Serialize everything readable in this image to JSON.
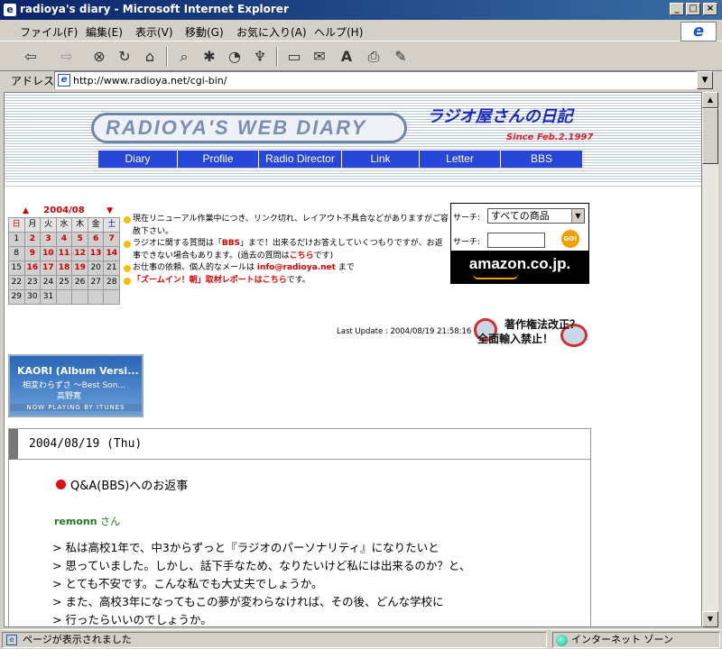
{
  "window": {
    "title": "radioya's diary - Microsoft Internet Explorer",
    "minimize": "_",
    "maximize": "□",
    "close": "×"
  },
  "menu": [
    "ファイル(F)",
    "編集(E)",
    "表示(V)",
    "移動(G)",
    "お気に入り(A)",
    "ヘルプ(H)"
  ],
  "toolbar": {
    "back": "⇦",
    "forward": "⇨",
    "stop": "⊗",
    "refresh": "↻",
    "home": "⌂",
    "search": "⌕",
    "favorites": "✱",
    "history": "◔",
    "channels": "♆",
    "fullscreen": "▭",
    "mail": "✉",
    "font": "A",
    "print": "⎙",
    "edit": "✎"
  },
  "address": {
    "label": "アドレス",
    "url": "http://www.radioya.net/cgi-bin/"
  },
  "banner": {
    "logo": "RADIOYA'S WEB DIARY",
    "jp_title": "ラジオ屋さんの日記",
    "since": "Since Feb.2.1997",
    "nav": [
      "Diary",
      "Profile",
      "Radio Director",
      "Link",
      "Letter",
      "BBS"
    ]
  },
  "calendar": {
    "month": "2004/08",
    "prev": "▲",
    "next": "▼",
    "weekdays": [
      "日",
      "月",
      "火",
      "水",
      "木",
      "金",
      "土"
    ],
    "weeks": [
      [
        "1",
        "2",
        "3",
        "4",
        "5",
        "6",
        "7"
      ],
      [
        "8",
        "9",
        "10",
        "11",
        "12",
        "13",
        "14"
      ],
      [
        "15",
        "16",
        "17",
        "18",
        "19",
        "20",
        "21"
      ],
      [
        "22",
        "23",
        "24",
        "25",
        "26",
        "27",
        "28"
      ],
      [
        "29",
        "30",
        "31",
        "",
        "",
        "",
        ""
      ]
    ]
  },
  "notices": {
    "n1": "現在リニューアル作業中につき、リンク切れ、レイアウト不具合などがありますがご容赦下さい。",
    "n2a": "ラジオに関する質問は「",
    "n2b": "BBS",
    "n2c": "」まで！出来るだけお答えしていくつもりですが、お返事できない場合もあります。(過去の質問は",
    "n2d": "こちら",
    "n2e": "です)",
    "n3a": "お仕事の依頼、個人的なメールは",
    "n3b": "info@radioya.net",
    "n3c": "まで",
    "n4a": "「ズームイン！朝」取材レポートはこちら",
    "n4b": "です。"
  },
  "amazon": {
    "search_label": "サーチ:",
    "select_value": "すべての商品",
    "search_label2": "サーチ:",
    "go": "GO!",
    "logo": "amazon.co.jp."
  },
  "last_update": "Last Update : 2004/08/19 21:58:16",
  "copyright": {
    "line1": "著作権法改正？",
    "line2": "全面輸入禁止！"
  },
  "itunes": {
    "line1": "KAORI (Album Versi...",
    "line2": "相変わらずさ ～Best Son...",
    "line3": "高野寛",
    "line4": "NOW PLAYING BY ITUNES"
  },
  "diary": {
    "date": "2004/08/19 (Thu)",
    "entry_title": "Q&A(BBS)へのお返事",
    "author_name": "remonn",
    "author_suffix": " さん",
    "quote": [
      "> 私は高校1年で、中3からずっと『ラジオのパーソナリティ』になりたいと",
      "> 思っていました。しかし、話下手なため、なりたいけど私には出来るのか？と、",
      "> とても不安です。こんな私でも大丈夫でしょうか。",
      "> また、高校3年になってもこの夢が変わらなければ、その後、どんな学校に",
      "> 行ったらいいのでしょうか。"
    ]
  },
  "status": {
    "main": "ページが表示されました",
    "zone": "インターネット ゾーン"
  }
}
